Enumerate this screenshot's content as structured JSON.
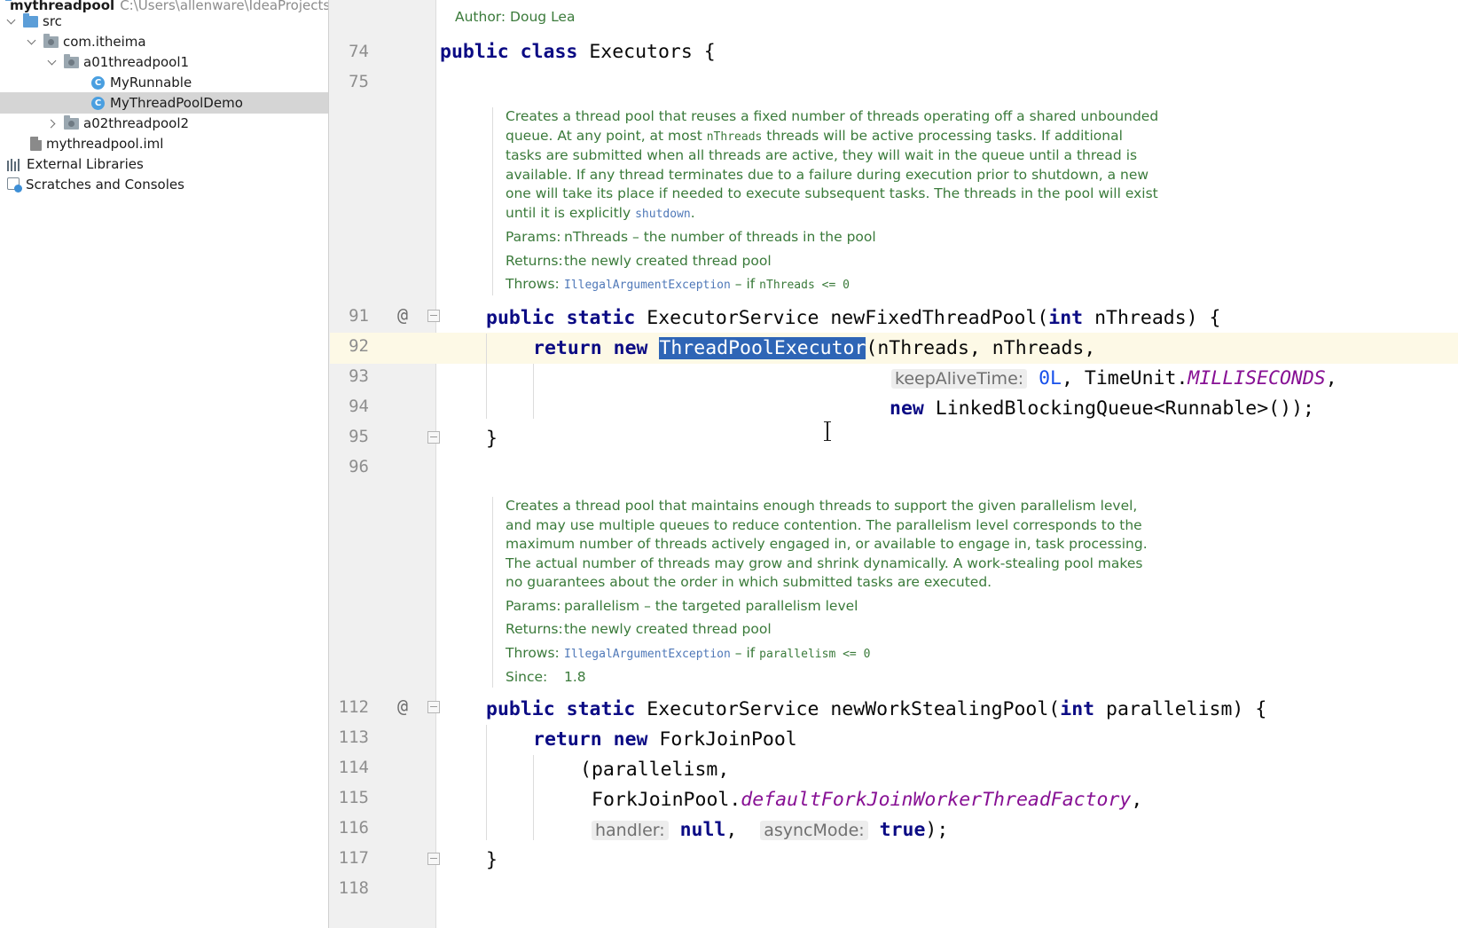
{
  "project": {
    "root_name": "mythreadpool",
    "root_path": "C:\\Users\\allenware\\IdeaProjects\\",
    "items": [
      {
        "label": "src"
      },
      {
        "label": "com.itheima"
      },
      {
        "label": "a01threadpool1"
      },
      {
        "label": "MyRunnable"
      },
      {
        "label": "MyThreadPoolDemo"
      },
      {
        "label": "a02threadpool2"
      },
      {
        "label": "mythreadpool.iml"
      },
      {
        "label": "External Libraries"
      },
      {
        "label": "Scratches and Consoles"
      }
    ]
  },
  "editor": {
    "author_line": "Author: Doug Lea",
    "line_numbers": [
      "74",
      "75",
      "91",
      "92",
      "93",
      "94",
      "95",
      "96",
      "112",
      "113",
      "114",
      "115",
      "116",
      "117",
      "118"
    ],
    "code": {
      "l74": {
        "kw1": "public",
        "kw2": "class",
        "rest": "Executors {"
      },
      "l91": {
        "kw1": "public",
        "kw2": "static",
        "type": "ExecutorService newFixedThreadPool(",
        "kw3": "int",
        "rest": "nThreads) {"
      },
      "l92": {
        "kw1": "return",
        "kw2": "new",
        "sel": "ThreadPoolExecutor",
        "rest": "(nThreads, nThreads,"
      },
      "l93": {
        "hint": "keepAliveTime:",
        "num": "0L",
        "mid": ", TimeUnit.",
        "stat": "MILLISECONDS",
        "end": ","
      },
      "l94": {
        "kw": "new",
        "rest": "LinkedBlockingQueue<Runnable>());"
      },
      "l95": "}",
      "l112": {
        "kw1": "public",
        "kw2": "static",
        "type": "ExecutorService newWorkStealingPool(",
        "kw3": "int",
        "rest": "parallelism) {"
      },
      "l113": {
        "kw1": "return",
        "kw2": "new",
        "rest": "ForkJoinPool"
      },
      "l114": "(parallelism,",
      "l115": {
        "pre": "ForkJoinPool.",
        "stat": "defaultForkJoinWorkerThreadFactory",
        "end": ","
      },
      "l116": {
        "hint1": "handler:",
        "kw1": "null",
        "sep": ",",
        "hint2": "asyncMode:",
        "kw2": "true",
        "end": ");"
      },
      "l117": "}"
    },
    "doc1": {
      "text_a": "Creates a thread pool that reuses a fixed number of threads operating off a shared unbounded queue. At any point, at most",
      "code_a": "nThreads",
      "text_b": "threads will be active processing tasks. If additional tasks are submitted when all threads are active, they will wait in the queue until a thread is available. If any thread terminates due to a failure during execution prior to shutdown, a new one will take its place if needed to execute subsequent tasks. The threads in the pool will exist until it is explicitly",
      "link_a": "shutdown",
      "text_c": ".",
      "params_label": "Params:",
      "params_value": "nThreads – the number of threads in the pool",
      "returns_label": "Returns:",
      "returns_value": "the newly created thread pool",
      "throws_label": "Throws:",
      "throws_link": "IllegalArgumentException",
      "throws_text": "– if",
      "throws_code": "nThreads <= 0"
    },
    "doc2": {
      "text": "Creates a thread pool that maintains enough threads to support the given parallelism level, and may use multiple queues to reduce contention. The parallelism level corresponds to the maximum number of threads actively engaged in, or available to engage in, task processing. The actual number of threads may grow and shrink dynamically. A work-stealing pool makes no guarantees about the order in which submitted tasks are executed.",
      "params_label": "Params:",
      "params_value": "parallelism – the targeted parallelism level",
      "returns_label": "Returns:",
      "returns_value": "the newly created thread pool",
      "throws_label": "Throws:",
      "throws_link": "IllegalArgumentException",
      "throws_text": "– if",
      "throws_code": "parallelism <= 0",
      "since_label": "Since:",
      "since_value": "1.8"
    }
  },
  "colors": {
    "keyword": "#0b0b84",
    "selection": "#2e65b6",
    "doc_text": "#3a7a3a",
    "static_field": "#871094",
    "number": "#1750eb",
    "current_line": "#fdf9e6"
  }
}
